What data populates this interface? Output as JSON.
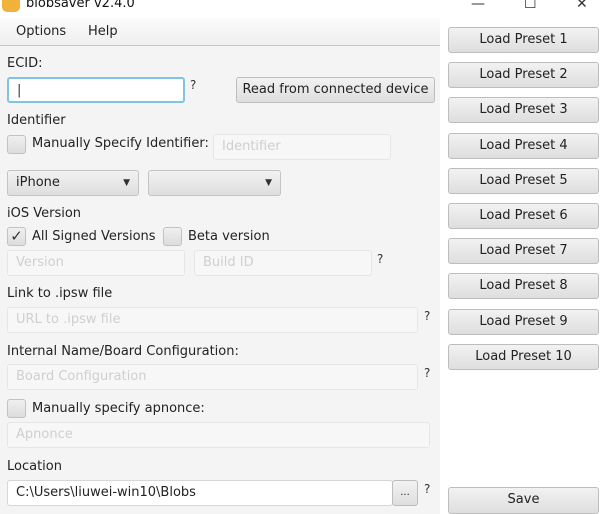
{
  "window": {
    "title": "blobsaver v2.4.0",
    "minimize": "—",
    "maximize": "☐",
    "close": "✕"
  },
  "menu": [
    "Options",
    "Help"
  ],
  "ecid": {
    "label": "ECID:",
    "value": "|",
    "help": "?",
    "read_button": "Read from connected device"
  },
  "identifier": {
    "label": "Identifier",
    "checkbox_label": "Manually Specify Identifier:",
    "checked": false,
    "placeholder": "Identifier"
  },
  "device": {
    "type": "iPhone",
    "model": ""
  },
  "ios": {
    "label": "iOS Version",
    "all_signed": "All Signed Versions",
    "all_signed_checked": true,
    "beta": "Beta version",
    "beta_checked": false,
    "version_placeholder": "Version",
    "build_placeholder": "Build ID",
    "help": "?"
  },
  "ipsw": {
    "label": "Link to .ipsw file",
    "placeholder": "URL to .ipsw file",
    "help": "?"
  },
  "board": {
    "label": "Internal Name/Board Configuration:",
    "placeholder": "Board Configuration",
    "help": "?"
  },
  "apnonce": {
    "checkbox_label": "Manually specify apnonce:",
    "checked": false,
    "placeholder": "Apnonce"
  },
  "location": {
    "label": "Location",
    "value": "C:\\Users\\liuwei-win10\\Blobs",
    "browse": "...",
    "help": "?"
  },
  "presets": [
    "Load Preset 1",
    "Load Preset 2",
    "Load Preset 3",
    "Load Preset 4",
    "Load Preset 5",
    "Load Preset 6",
    "Load Preset 7",
    "Load Preset 8",
    "Load Preset 9",
    "Load Preset 10"
  ],
  "save": "Save"
}
